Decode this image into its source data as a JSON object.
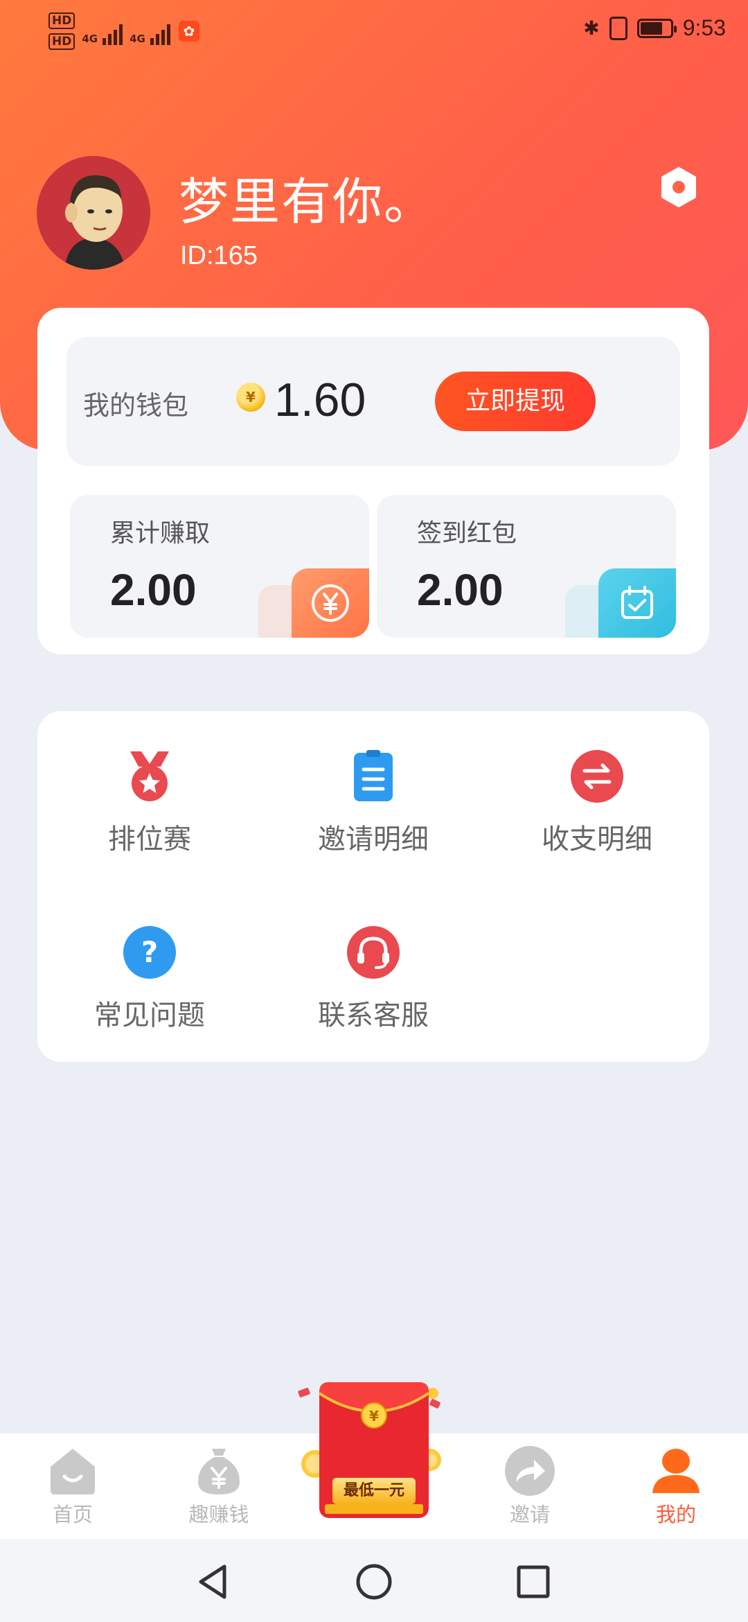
{
  "status_bar": {
    "hd1": "HD",
    "hd2": "HD",
    "net1": "4G",
    "net2": "4G",
    "time": "9:53",
    "battery_level": 0.75
  },
  "profile": {
    "name": "梦里有你。",
    "id": "ID:165"
  },
  "wallet": {
    "label": "我的钱包",
    "coin_symbol": "¥",
    "balance": "1.60",
    "withdraw_label": "立即提现"
  },
  "stats": {
    "earned_label": "累计赚取",
    "earned_value": "2.00",
    "checkin_label": "签到红包",
    "checkin_value": "2.00"
  },
  "menu": {
    "items": [
      {
        "label": "排位赛",
        "icon": "medal-icon"
      },
      {
        "label": "邀请明细",
        "icon": "clipboard-icon"
      },
      {
        "label": "收支明细",
        "icon": "transfer-icon"
      },
      {
        "label": "常见问题",
        "icon": "question-icon"
      },
      {
        "label": "联系客服",
        "icon": "headset-icon"
      }
    ]
  },
  "bottom_nav": {
    "home": "首页",
    "earn": "趣赚钱",
    "center_tag": "最低一元",
    "invite": "邀请",
    "mine": "我的"
  },
  "colors": {
    "header_start": "#FF7A3D",
    "header_end": "#FF5757",
    "accent": "#FF5A3C"
  }
}
